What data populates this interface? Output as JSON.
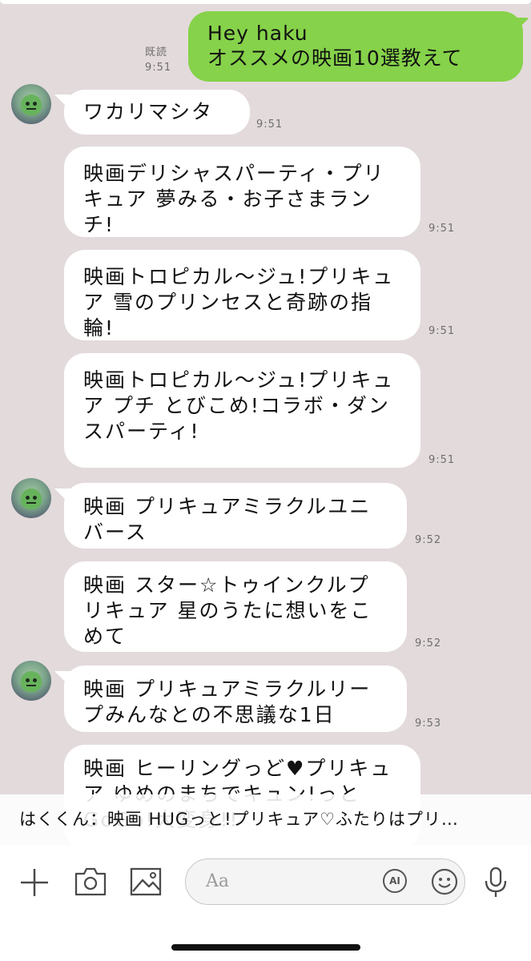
{
  "messages": {
    "sent": {
      "text_line1": "Hey haku",
      "text_line2": "オススメの映画10選教えて",
      "read_label": "既読",
      "time": "9:51"
    },
    "received": [
      {
        "text": "ワカリマシタ",
        "time": "9:51"
      },
      {
        "text": "映画デリシャスパーティ・プリキュア 夢みる・お子さまランチ!",
        "time": "9:51"
      },
      {
        "text": "映画トロピカル〜ジュ!プリキュア 雪のプリンセスと奇跡の指輪!",
        "time": "9:51"
      },
      {
        "text": "映画トロピカル〜ジュ!プリキュア プチ とびこめ!コラボ・ダンスパーティ!",
        "time": "9:51"
      },
      {
        "text": "映画 プリキュアミラクルユニバース",
        "time": "9:52"
      },
      {
        "text": "映画 スター☆トゥインクルプリキュア 星のうたに想いをこめて",
        "time": "9:52"
      },
      {
        "text": "映画 プリキュアミラクルリープみんなとの不思議な1日",
        "time": "9:53"
      },
      {
        "text": "映画 ヒーリングっど♥プリキュア ゆめのまちでキュン!っとGoGo!大変身!!",
        "time": ""
      }
    ]
  },
  "notification": {
    "text": "はくくん：映画 HUGっと!プリキュア♡ふたりはプリ…"
  },
  "input_bar": {
    "placeholder": "Aa",
    "icons": [
      "plus-icon",
      "camera-icon",
      "image-icon",
      "ai-icon",
      "emoji-icon",
      "microphone-icon"
    ],
    "ai_label": "AI"
  },
  "colors": {
    "chat_background": "#e3dadb",
    "sent_bubble": "#86d24a",
    "received_bubble": "#ffffff"
  }
}
